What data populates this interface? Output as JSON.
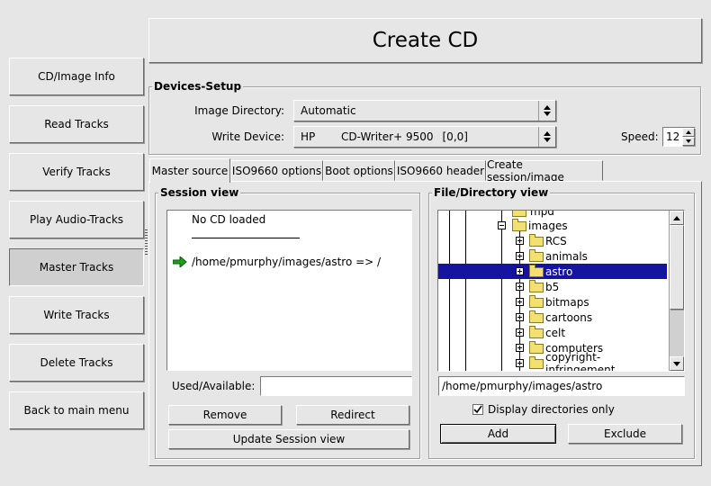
{
  "title": "Create CD",
  "sidebar": {
    "items": [
      {
        "label": "CD/Image Info"
      },
      {
        "label": "Read Tracks"
      },
      {
        "label": "Verify Tracks"
      },
      {
        "label": "Play Audio-Tracks"
      },
      {
        "label": "Master Tracks"
      },
      {
        "label": "Write Tracks"
      },
      {
        "label": "Delete Tracks"
      },
      {
        "label": "Back to main menu"
      }
    ],
    "active_index": 4
  },
  "devices_setup": {
    "group_label": "Devices-Setup",
    "image_directory_label": "Image Directory:",
    "image_directory_value": "Automatic",
    "write_device_label": "Write Device:",
    "write_device_vendor": "HP",
    "write_device_model": "CD-Writer+ 9500",
    "write_device_bus": "[0,0]",
    "speed_label": "Speed:",
    "speed_value": "12"
  },
  "tabs": [
    {
      "label": "Master source"
    },
    {
      "label": "ISO9660 options"
    },
    {
      "label": "Boot options"
    },
    {
      "label": "ISO9660 header"
    },
    {
      "label": "Create session/image"
    }
  ],
  "active_tab": 0,
  "session_view": {
    "group_label": "Session view",
    "no_cd_text": "No CD loaded",
    "entry": "/home/pmurphy/images/astro => /",
    "used_available_label": "Used/Available:",
    "used_available_value": "",
    "remove_label": "Remove",
    "redirect_label": "Redirect",
    "update_label": "Update Session view"
  },
  "file_view": {
    "group_label": "File/Directory view",
    "partial_top": "mpd",
    "parent_folder": "images",
    "children": [
      "RCS",
      "animals",
      "astro",
      "b5",
      "bitmaps",
      "cartoons",
      "celt",
      "computers",
      "copyright-infringement"
    ],
    "selected_index": 2,
    "path_value": "/home/pmurphy/images/astro",
    "display_dirs_label": "Display directories only",
    "display_dirs_checked": true,
    "add_label": "Add",
    "exclude_label": "Exclude"
  },
  "colors": {
    "background": "#e6e6e6",
    "selection": "#1414a0",
    "folder": "#f2e070",
    "arrow": "#1e9e1e"
  }
}
